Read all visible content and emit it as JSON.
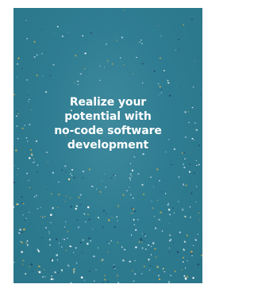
{
  "card": {
    "headline_lines": [
      "Realize your",
      "potential with",
      "no-code software",
      "development"
    ]
  },
  "colors": {
    "background": "#2f7d92",
    "page": "#ffffff",
    "text": "#ffffff",
    "confetti_white": "#ffffff",
    "confetti_navy": "#1f3b62",
    "confetti_gold": "#d8b24a",
    "confetti_light": "#b9dbe4"
  }
}
